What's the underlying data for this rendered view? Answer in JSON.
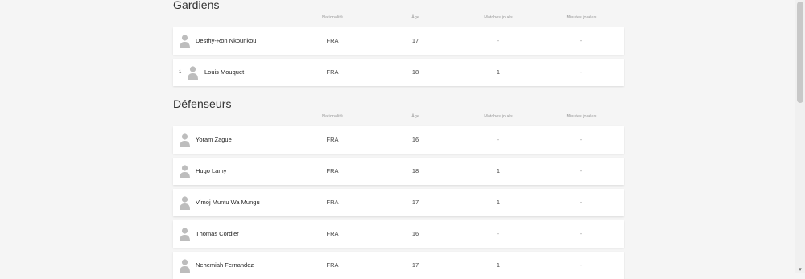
{
  "columns": {
    "nationality": "Nationalité",
    "age": "Âge",
    "matches": "Matches joués",
    "minutes": "Minutes jouées"
  },
  "sections": [
    {
      "title": "Gardiens",
      "players": [
        {
          "number": "",
          "name": "Desthy-Ron Nkounkou",
          "nationality": "FRA",
          "age": "17",
          "matches": "-",
          "minutes": "-"
        },
        {
          "number": "1",
          "name": "Louis Mouquet",
          "nationality": "FRA",
          "age": "18",
          "matches": "1",
          "minutes": "-"
        }
      ]
    },
    {
      "title": "Défenseurs",
      "players": [
        {
          "number": "",
          "name": "Yoram Zague",
          "nationality": "FRA",
          "age": "16",
          "matches": "-",
          "minutes": "-"
        },
        {
          "number": "",
          "name": "Hugo Lamy",
          "nationality": "FRA",
          "age": "18",
          "matches": "1",
          "minutes": "-"
        },
        {
          "number": "",
          "name": "Vimoj Muntu Wa Mungu",
          "nationality": "FRA",
          "age": "17",
          "matches": "1",
          "minutes": "-"
        },
        {
          "number": "",
          "name": "Thomas Cordier",
          "nationality": "FRA",
          "age": "16",
          "matches": "-",
          "minutes": "-"
        },
        {
          "number": "",
          "name": "Nehemiah Fernandez",
          "nationality": "FRA",
          "age": "17",
          "matches": "1",
          "minutes": "-"
        }
      ]
    }
  ],
  "icons": {
    "avatar": "player-avatar-placeholder-icon",
    "scroll_down": "chevron-down-icon"
  },
  "colors": {
    "background": "#f5f5f5",
    "row_background": "#ffffff",
    "muted_text": "#9a9a9a",
    "avatar": "#bdbdbd"
  }
}
